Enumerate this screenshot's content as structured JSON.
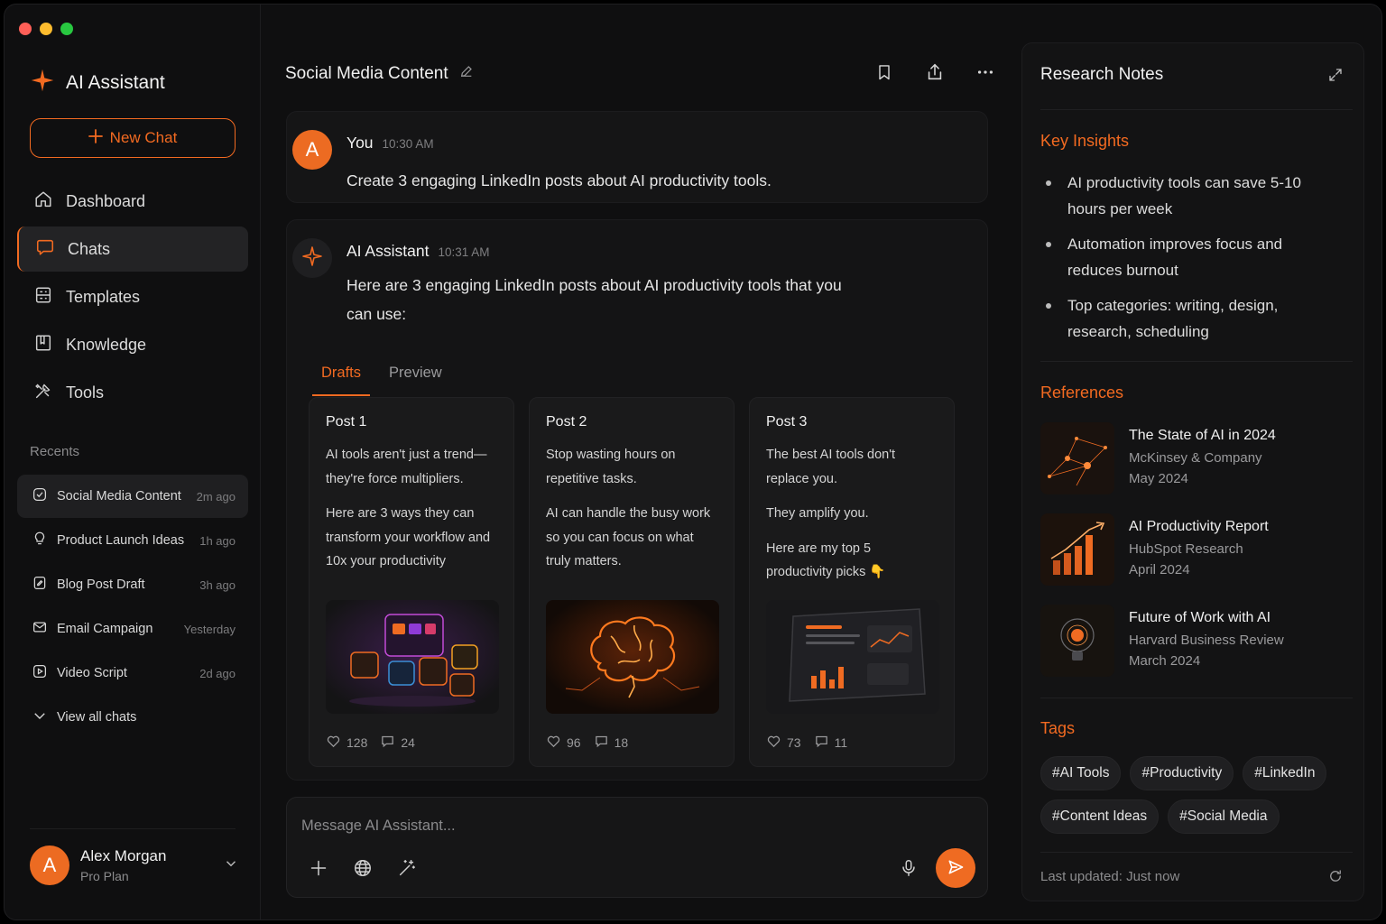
{
  "app": {
    "name": "AI Assistant",
    "accent": "#f26a21"
  },
  "sidebar": {
    "new_chat": "New Chat",
    "nav": [
      {
        "label": "Dashboard",
        "icon": "home-icon"
      },
      {
        "label": "Chats",
        "icon": "chat-icon",
        "active": true
      },
      {
        "label": "Templates",
        "icon": "template-icon"
      },
      {
        "label": "Knowledge",
        "icon": "book-icon"
      },
      {
        "label": "Tools",
        "icon": "tools-icon"
      }
    ],
    "recents_label": "Recents",
    "recents": [
      {
        "label": "Social Media Content",
        "time": "2m ago",
        "icon": "check-circle-icon",
        "active": true
      },
      {
        "label": "Product Launch Ideas",
        "time": "1h ago",
        "icon": "lightbulb-icon"
      },
      {
        "label": "Blog Post Draft",
        "time": "3h ago",
        "icon": "document-icon"
      },
      {
        "label": "Email Campaign",
        "time": "Yesterday",
        "icon": "mail-icon"
      },
      {
        "label": "Video Script",
        "time": "2d ago",
        "icon": "video-icon"
      }
    ],
    "view_all": "View all chats",
    "user": {
      "initial": "A",
      "name": "Alex Morgan",
      "plan": "Pro Plan"
    }
  },
  "main": {
    "title": "Social Media Content",
    "user_message": {
      "initial": "A",
      "author": "You",
      "time": "10:30 AM",
      "text": "Create 3 engaging LinkedIn posts about AI productivity tools."
    },
    "ai_message": {
      "author": "AI Assistant",
      "time": "10:31 AM",
      "text": "Here are 3 engaging LinkedIn posts about AI productivity tools that you can use:",
      "tabs": [
        "Drafts",
        "Preview"
      ],
      "posts": [
        {
          "title": "Post 1",
          "paragraphs": [
            "AI tools aren't just a trend—they're force multipliers.",
            "Here are 3 ways they can transform your workflow and 10x your productivity"
          ],
          "likes": "128",
          "comments": "24",
          "image": "app-icons-image"
        },
        {
          "title": "Post 2",
          "paragraphs": [
            "Stop wasting hours on repetitive tasks.",
            "AI can handle the busy work so you can focus on what truly matters."
          ],
          "likes": "96",
          "comments": "18",
          "image": "glowing-brain-image"
        },
        {
          "title": "Post 3",
          "paragraphs": [
            "The best AI tools don't replace you.",
            "They amplify you.",
            "Here are my top 5 productivity picks 👇"
          ],
          "likes": "73",
          "comments": "11",
          "image": "tablet-dashboard-image"
        }
      ]
    },
    "composer": {
      "placeholder": "Message AI Assistant..."
    }
  },
  "panel": {
    "title": "Research Notes",
    "insights_title": "Key Insights",
    "insights": [
      "AI productivity tools can save 5-10 hours per week",
      "Automation improves focus and reduces burnout",
      "Top categories: writing, design, research, scheduling"
    ],
    "references_title": "References",
    "references": [
      {
        "title": "The State of AI in 2024",
        "source": "McKinsey & Company",
        "date": "May 2024",
        "thumb": "network-thumbnail"
      },
      {
        "title": "AI Productivity Report",
        "source": "HubSpot Research",
        "date": "April 2024",
        "thumb": "bar-chart-thumbnail"
      },
      {
        "title": "Future of Work with AI",
        "source": "Harvard Business Review",
        "date": "March 2024",
        "thumb": "lightbulb-thumbnail"
      }
    ],
    "tags_title": "Tags",
    "tags": [
      "#AI Tools",
      "#Productivity",
      "#LinkedIn",
      "#Content Ideas",
      "#Social Media"
    ],
    "updated": "Last updated: Just now"
  }
}
